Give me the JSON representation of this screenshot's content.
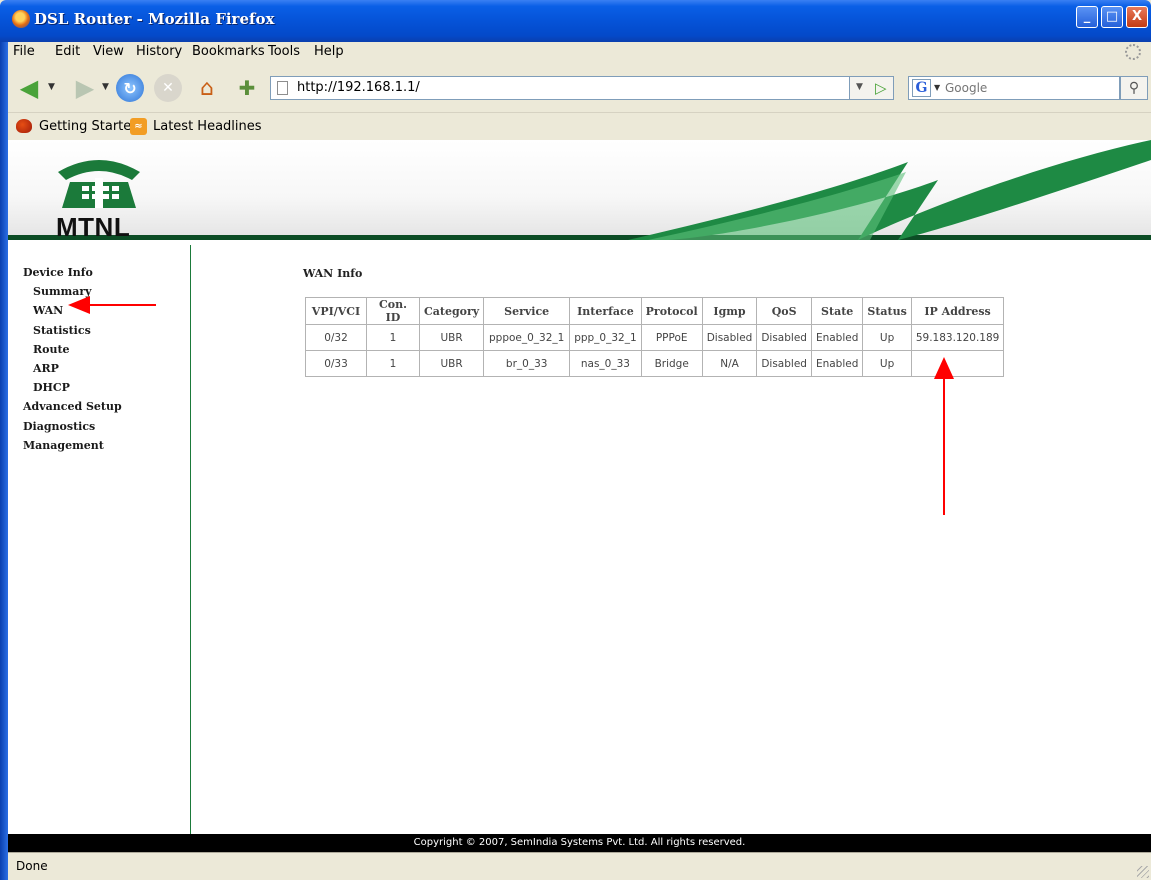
{
  "window": {
    "title": "DSL Router - Mozilla Firefox",
    "min": "_",
    "max": "□",
    "close": "X"
  },
  "menu": [
    "File",
    "Edit",
    "View",
    "History",
    "Bookmarks",
    "Tools",
    "Help"
  ],
  "toolbar": {
    "url": "http://192.168.1.1/",
    "search_engine": "G",
    "search_placeholder": "Google"
  },
  "bookmarks": [
    "Getting Started",
    "Latest Headlines"
  ],
  "brand": {
    "logo_text": "MTNL",
    "accent_color": "#1b7a3a"
  },
  "sidebar": {
    "items": [
      {
        "label": "Device Info",
        "level": 0
      },
      {
        "label": "Summary",
        "level": 1
      },
      {
        "label": "WAN",
        "level": 1
      },
      {
        "label": "Statistics",
        "level": 1
      },
      {
        "label": "Route",
        "level": 1
      },
      {
        "label": "ARP",
        "level": 1
      },
      {
        "label": "DHCP",
        "level": 1
      },
      {
        "label": "Advanced Setup",
        "level": 0
      },
      {
        "label": "Diagnostics",
        "level": 0
      },
      {
        "label": "Management",
        "level": 0
      }
    ]
  },
  "main": {
    "title": "WAN Info",
    "columns": [
      "VPI/VCI",
      "Con. ID",
      "Category",
      "Service",
      "Interface",
      "Protocol",
      "Igmp",
      "QoS",
      "State",
      "Status",
      "IP Address"
    ],
    "rows": [
      [
        "0/32",
        "1",
        "UBR",
        "pppoe_0_32_1",
        "ppp_0_32_1",
        "PPPoE",
        "Disabled",
        "Disabled",
        "Enabled",
        "Up",
        "59.183.120.189"
      ],
      [
        "0/33",
        "1",
        "UBR",
        "br_0_33",
        "nas_0_33",
        "Bridge",
        "N/A",
        "Disabled",
        "Enabled",
        "Up",
        ""
      ]
    ]
  },
  "footer": "Copyright © 2007, SemIndia Systems Pvt. Ltd. All rights reserved.",
  "statusbar": "Done"
}
